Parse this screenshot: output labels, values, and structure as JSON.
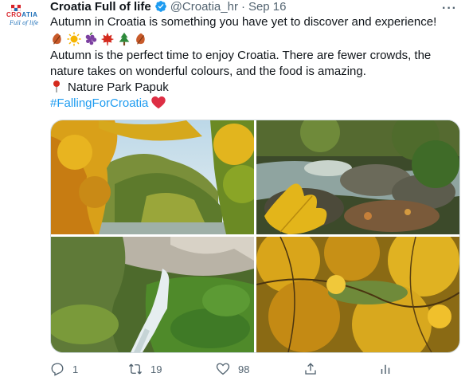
{
  "tweet": {
    "author_name": "Croatia Full of life",
    "handle": "@Croatia_hr",
    "separator": "·",
    "date": "Sep 16",
    "more_label": "···",
    "avatar": {
      "logo_text_red": "CRO",
      "logo_text_blue": "ATIA",
      "tagline": "Full of life"
    },
    "lines": {
      "line1": "Autumn in Croatia is something you have yet to discover and experience!",
      "line2": "Autumn is the perfect time to enjoy Croatia. There are fewer crowds, the",
      "line3": "nature takes on wonderful colours, and the food is amazing.",
      "location": "Nature Park Papuk",
      "hashtag": "#FallingForCroatia"
    },
    "emojis": [
      "fallen-leaf-icon",
      "sun-icon",
      "grapes-icon",
      "maple-leaf-icon",
      "evergreen-tree-icon",
      "fallen-leaf-icon"
    ],
    "media": [
      {
        "name": "photo-autumn-forest-river"
      },
      {
        "name": "photo-stream-yellow-leaf"
      },
      {
        "name": "photo-waterfall-moss"
      },
      {
        "name": "photo-yellow-canopy"
      }
    ],
    "actions": {
      "replies": "1",
      "retweets": "19",
      "likes": "98"
    },
    "colors": {
      "accent": "#1d9bf0",
      "muted": "#536471",
      "heart": "#e0245e"
    }
  }
}
